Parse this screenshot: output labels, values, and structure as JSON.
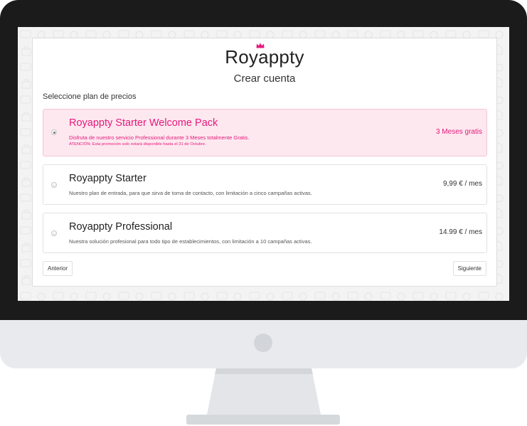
{
  "brand": {
    "name": "Royappty",
    "accent": "#e5197c"
  },
  "page": {
    "title": "Crear cuenta",
    "section_label": "Seleccione plan de precios"
  },
  "plans": [
    {
      "name": "Royappty Starter Welcome Pack",
      "description": "Disfruta de nuestro servicio Professional durante 3 Meses totalmente Gratis.",
      "note": "ATENCIÓN: Esta promoción solo estará disponible hasta el 31 de Octubre.",
      "price": "3 Meses gratis",
      "selected": true
    },
    {
      "name": "Royappty Starter",
      "description": "Nuestro plan de entrada, para que sirva de toma de contacto, con limitación a cinco campañas activas.",
      "price": "9,99 € / mes",
      "selected": false
    },
    {
      "name": "Royappty Professional",
      "description": "Nuestra solución profesional para todo tipo de establecimientos, con limitación a 10 campañas activas.",
      "price": "14.99 € / mes",
      "selected": false
    }
  ],
  "buttons": {
    "prev": "Anterior",
    "next": "Siguiente"
  }
}
